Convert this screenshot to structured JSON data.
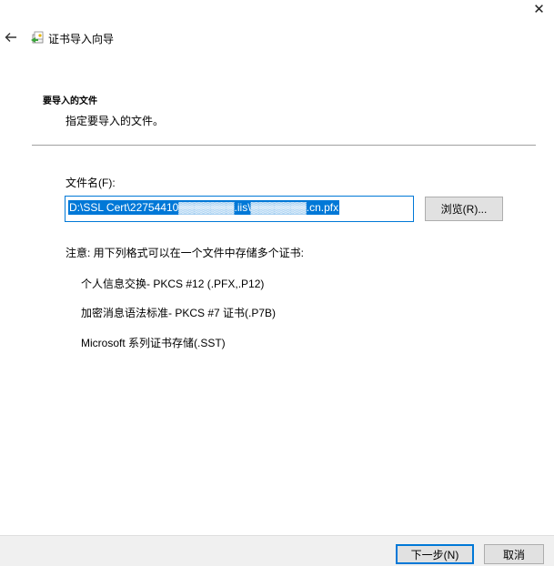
{
  "titlebar": {
    "close_symbol": "✕",
    "back_icon": "back-arrow-icon",
    "wizard_icon": "certificate-wizard-icon"
  },
  "wizard": {
    "title": "证书导入向导"
  },
  "page": {
    "heading": "要导入的文件",
    "description": "指定要导入的文件。"
  },
  "file": {
    "label": "文件名(F):",
    "value": "D:\\SSL Cert\\22754410▓▓▓▓▓▓▓.iis\\▓▓▓▓▓▓▓.cn.pfx",
    "browse_label": "浏览(R)..."
  },
  "note": {
    "label": "注意: 用下列格式可以在一个文件中存储多个证书:",
    "formats": [
      "个人信息交换- PKCS #12 (.PFX,.P12)",
      "加密消息语法标准- PKCS #7 证书(.P7B)",
      "Microsoft 系列证书存储(.SST)"
    ]
  },
  "footer": {
    "next_label": "下一步(N)",
    "cancel_label": "取消"
  },
  "colors": {
    "accent": "#0078d7",
    "button_bg": "#e1e1e1",
    "footer_bg": "#f0f0f0"
  }
}
